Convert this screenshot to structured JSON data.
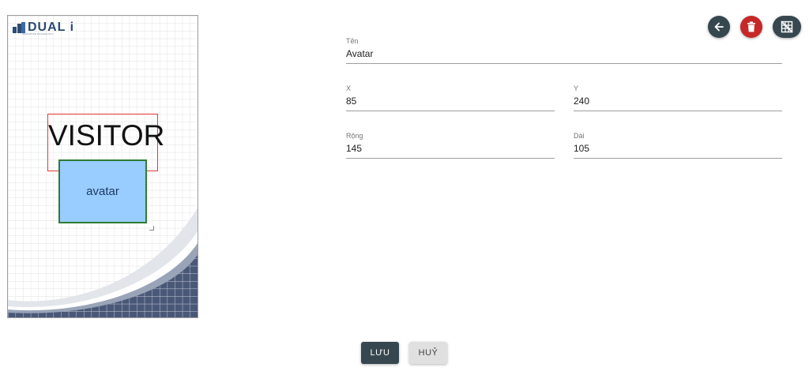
{
  "colors": {
    "primary_dark": "#37474f",
    "danger": "#c62828",
    "avatar_fill": "#99ccff",
    "avatar_border": "#2e7d32",
    "name_border": "#e53935",
    "wave_navy": "#4a5878"
  },
  "badge": {
    "logo_text": "DUAL i",
    "logo_tagline": "INNOVATIVE TECHNOLOGY",
    "name_text": "VISITOR",
    "avatar_label": "avatar"
  },
  "form": {
    "ten": {
      "label": "Tên",
      "value": "Avatar"
    },
    "x": {
      "label": "X",
      "value": "85"
    },
    "y": {
      "label": "Y",
      "value": "240"
    },
    "rong": {
      "label": "Rộng",
      "value": "145"
    },
    "dai": {
      "label": "Dài",
      "value": "105"
    }
  },
  "actions": {
    "back_icon": "arrow-left-icon",
    "delete_icon": "trash-icon",
    "grid_icon": "grid-off-icon"
  },
  "buttons": {
    "save": "LƯU",
    "cancel": "HUỶ"
  }
}
